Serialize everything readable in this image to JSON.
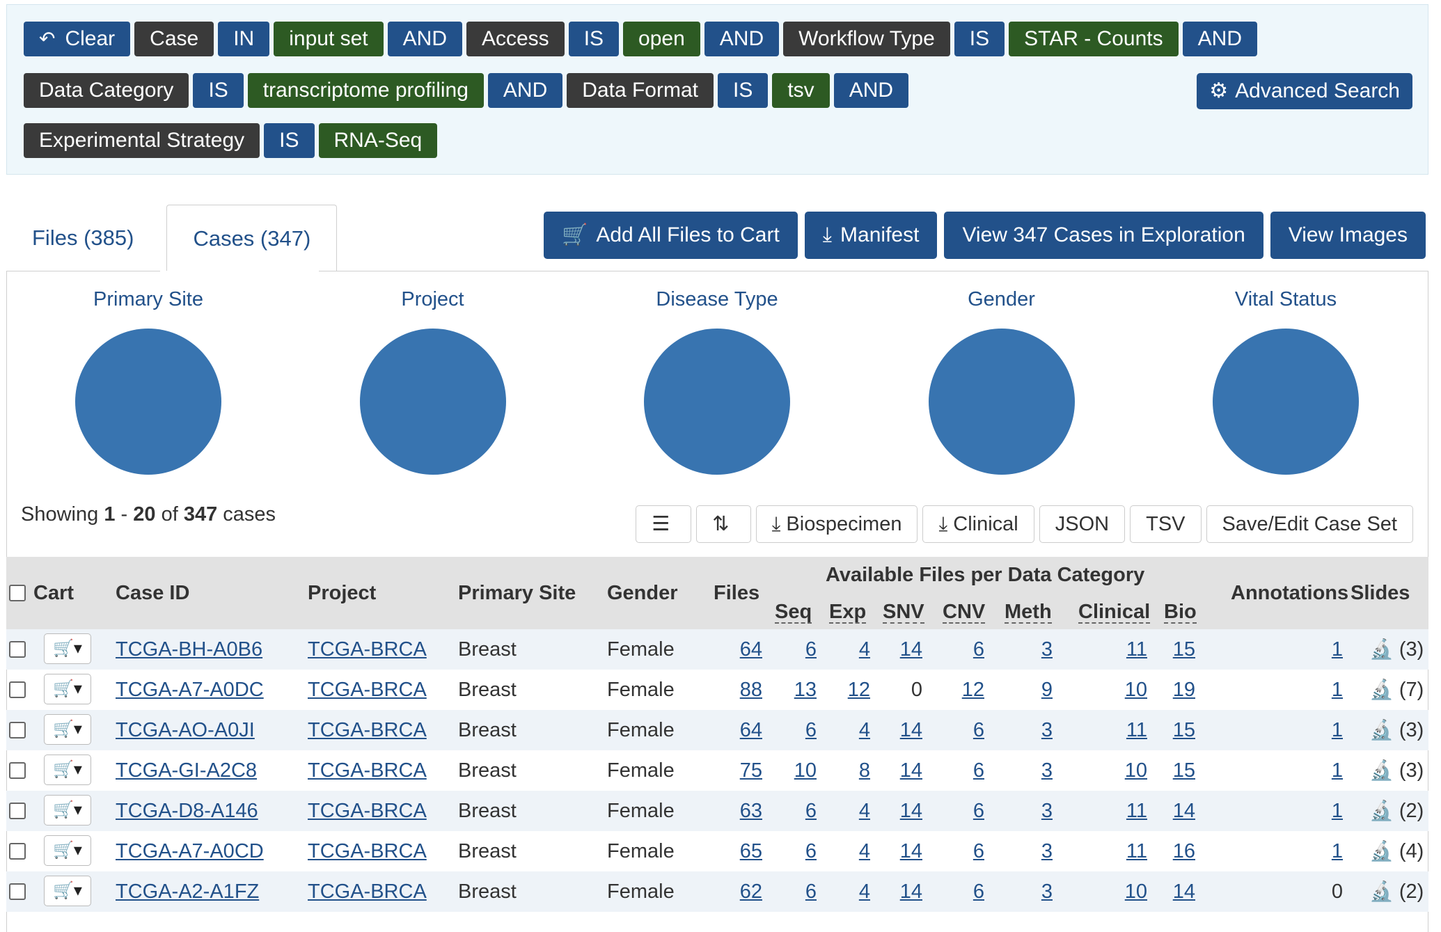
{
  "query": {
    "rows": [
      [
        {
          "text": "Clear",
          "style": "blue",
          "icon": "undo-icon",
          "glyph": "↶"
        },
        {
          "text": "Case",
          "style": "dark"
        },
        {
          "text": "IN",
          "style": "blue"
        },
        {
          "text": "input set",
          "style": "green"
        },
        {
          "text": "AND",
          "style": "blue"
        },
        {
          "text": "Access",
          "style": "dark"
        },
        {
          "text": "IS",
          "style": "blue"
        },
        {
          "text": "open",
          "style": "green"
        },
        {
          "text": "AND",
          "style": "blue"
        },
        {
          "text": "Workflow Type",
          "style": "dark"
        },
        {
          "text": "IS",
          "style": "blue"
        },
        {
          "text": "STAR - Counts",
          "style": "green"
        },
        {
          "text": "AND",
          "style": "blue"
        }
      ],
      [
        {
          "text": "Data Category",
          "style": "dark"
        },
        {
          "text": "IS",
          "style": "blue"
        },
        {
          "text": "transcriptome profiling",
          "style": "green"
        },
        {
          "text": "AND",
          "style": "blue"
        },
        {
          "text": "Data Format",
          "style": "dark"
        },
        {
          "text": "IS",
          "style": "blue"
        },
        {
          "text": "tsv",
          "style": "green"
        },
        {
          "text": "AND",
          "style": "blue"
        }
      ],
      [
        {
          "text": "Experimental Strategy",
          "style": "dark"
        },
        {
          "text": "IS",
          "style": "blue"
        },
        {
          "text": "RNA-Seq",
          "style": "green"
        }
      ]
    ],
    "advanced_search": {
      "label": "Advanced Search",
      "icon": "gears-icon",
      "glyph": "⚙"
    }
  },
  "tabs": [
    {
      "label": "Files (385)",
      "active": false
    },
    {
      "label": "Cases (347)",
      "active": true
    }
  ],
  "actions": [
    {
      "label": "Add All Files to Cart",
      "icon": "cart-icon",
      "glyph": "🛒"
    },
    {
      "label": "Manifest",
      "icon": "download-icon",
      "glyph": "⤓"
    },
    {
      "label": "View 347 Cases in Exploration",
      "icon": "",
      "glyph": ""
    },
    {
      "label": "View Images",
      "icon": "",
      "glyph": ""
    }
  ],
  "charts": [
    "Primary Site",
    "Project",
    "Disease Type",
    "Gender",
    "Vital Status"
  ],
  "colors": {
    "primary": "#22518a",
    "dark_pill": "#3a3a3a",
    "green_pill": "#2d5a23",
    "pie": "#3874b0"
  },
  "showing": {
    "prefix": "Showing",
    "start": "1",
    "sep": "-",
    "end": "20",
    "of": "of",
    "total": "347",
    "suffix": "cases"
  },
  "tools": [
    {
      "label": "",
      "icon": "list-icon",
      "glyph": "☰"
    },
    {
      "label": "",
      "icon": "sort-icon",
      "glyph": "⇅"
    },
    {
      "label": "Biospecimen",
      "icon": "download-icon",
      "glyph": "⤓"
    },
    {
      "label": "Clinical",
      "icon": "download-icon",
      "glyph": "⤓"
    },
    {
      "label": "JSON",
      "icon": "",
      "glyph": ""
    },
    {
      "label": "TSV",
      "icon": "",
      "glyph": ""
    },
    {
      "label": "Save/Edit Case Set",
      "icon": "",
      "glyph": ""
    }
  ],
  "table": {
    "headers": {
      "cart": "Cart",
      "case_id": "Case ID",
      "project": "Project",
      "primary_site": "Primary Site",
      "gender": "Gender",
      "files": "Files",
      "group": "Available Files per Data Category",
      "seq": "Seq",
      "exp": "Exp",
      "snv": "SNV",
      "cnv": "CNV",
      "meth": "Meth",
      "clinical": "Clinical",
      "bio": "Bio",
      "annotations": "Annotations",
      "slides": "Slides"
    },
    "rows": [
      {
        "case_id": "TCGA-BH-A0B6",
        "project": "TCGA-BRCA",
        "site": "Breast",
        "gender": "Female",
        "files": "64",
        "seq": "6",
        "exp": "4",
        "snv": "14",
        "cnv": "6",
        "meth": "3",
        "clinical": "11",
        "bio": "15",
        "annotations": "1",
        "slides": "(3)"
      },
      {
        "case_id": "TCGA-A7-A0DC",
        "project": "TCGA-BRCA",
        "site": "Breast",
        "gender": "Female",
        "files": "88",
        "seq": "13",
        "exp": "12",
        "snv": "0",
        "cnv": "12",
        "meth": "9",
        "clinical": "10",
        "bio": "19",
        "annotations": "1",
        "slides": "(7)"
      },
      {
        "case_id": "TCGA-AO-A0JI",
        "project": "TCGA-BRCA",
        "site": "Breast",
        "gender": "Female",
        "files": "64",
        "seq": "6",
        "exp": "4",
        "snv": "14",
        "cnv": "6",
        "meth": "3",
        "clinical": "11",
        "bio": "15",
        "annotations": "1",
        "slides": "(3)"
      },
      {
        "case_id": "TCGA-GI-A2C8",
        "project": "TCGA-BRCA",
        "site": "Breast",
        "gender": "Female",
        "files": "75",
        "seq": "10",
        "exp": "8",
        "snv": "14",
        "cnv": "6",
        "meth": "3",
        "clinical": "10",
        "bio": "15",
        "annotations": "1",
        "slides": "(3)"
      },
      {
        "case_id": "TCGA-D8-A146",
        "project": "TCGA-BRCA",
        "site": "Breast",
        "gender": "Female",
        "files": "63",
        "seq": "6",
        "exp": "4",
        "snv": "14",
        "cnv": "6",
        "meth": "3",
        "clinical": "11",
        "bio": "14",
        "annotations": "1",
        "slides": "(2)"
      },
      {
        "case_id": "TCGA-A7-A0CD",
        "project": "TCGA-BRCA",
        "site": "Breast",
        "gender": "Female",
        "files": "65",
        "seq": "6",
        "exp": "4",
        "snv": "14",
        "cnv": "6",
        "meth": "3",
        "clinical": "11",
        "bio": "16",
        "annotations": "1",
        "slides": "(4)"
      },
      {
        "case_id": "TCGA-A2-A1FZ",
        "project": "TCGA-BRCA",
        "site": "Breast",
        "gender": "Female",
        "files": "62",
        "seq": "6",
        "exp": "4",
        "snv": "14",
        "cnv": "6",
        "meth": "3",
        "clinical": "10",
        "bio": "14",
        "annotations": "0",
        "slides": "(2)"
      }
    ]
  }
}
